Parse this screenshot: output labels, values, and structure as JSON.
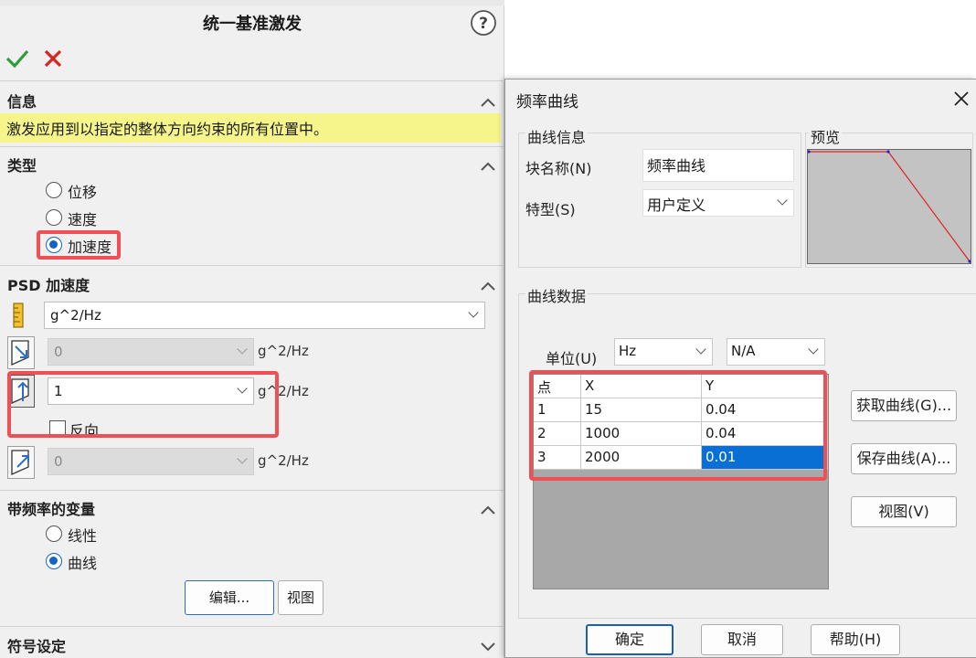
{
  "left_panel": {
    "title": "统一基准激发",
    "help_icon": "question-circle-icon",
    "ok_icon": "check-icon",
    "cancel_icon": "x-icon",
    "info": {
      "title": "信息",
      "message": "激发应用到以指定的整体方向约束的所有位置中。"
    },
    "type": {
      "title": "类型",
      "options": [
        {
          "label": "位移",
          "selected": false
        },
        {
          "label": "速度",
          "selected": false
        },
        {
          "label": "加速度",
          "selected": true
        }
      ]
    },
    "psd": {
      "title": "PSD 加速度",
      "unit_select": "g^2/Hz",
      "rows": [
        {
          "value": "0",
          "unit": "g^2/Hz",
          "enabled": false
        },
        {
          "value": "1",
          "unit": "g^2/Hz",
          "enabled": true
        },
        {
          "value": "0",
          "unit": "g^2/Hz",
          "enabled": false
        }
      ],
      "reverse_label": "反向"
    },
    "freq_var": {
      "title": "带频率的变量",
      "options": [
        {
          "label": "线性",
          "selected": false
        },
        {
          "label": "曲线",
          "selected": true
        }
      ],
      "edit_button": "编辑...",
      "view_button": "视图"
    },
    "symbol": {
      "title": "符号设定"
    }
  },
  "dialog": {
    "title": "频率曲线",
    "close_icon": "close-icon",
    "curve_info": {
      "title": "曲线信息",
      "name_label": "块名称(N)",
      "name_value": "频率曲线",
      "type_label": "特型(S)",
      "type_value": "用户定义"
    },
    "preview": {
      "title": "预览"
    },
    "curve_data": {
      "title": "曲线数据",
      "unit_label": "单位(U)",
      "unit_x": "Hz",
      "unit_y": "N/A",
      "columns": [
        "点",
        "X",
        "Y"
      ],
      "rows": [
        [
          "1",
          "15",
          "0.04"
        ],
        [
          "2",
          "1000",
          "0.04"
        ],
        [
          "3",
          "2000",
          "0.01"
        ]
      ]
    },
    "buttons": {
      "get_curve": "获取曲线(G)...",
      "save_curve": "保存曲线(A)...",
      "view": "视图(V)",
      "ok": "确定",
      "cancel": "取消",
      "help": "帮助(H)"
    }
  }
}
